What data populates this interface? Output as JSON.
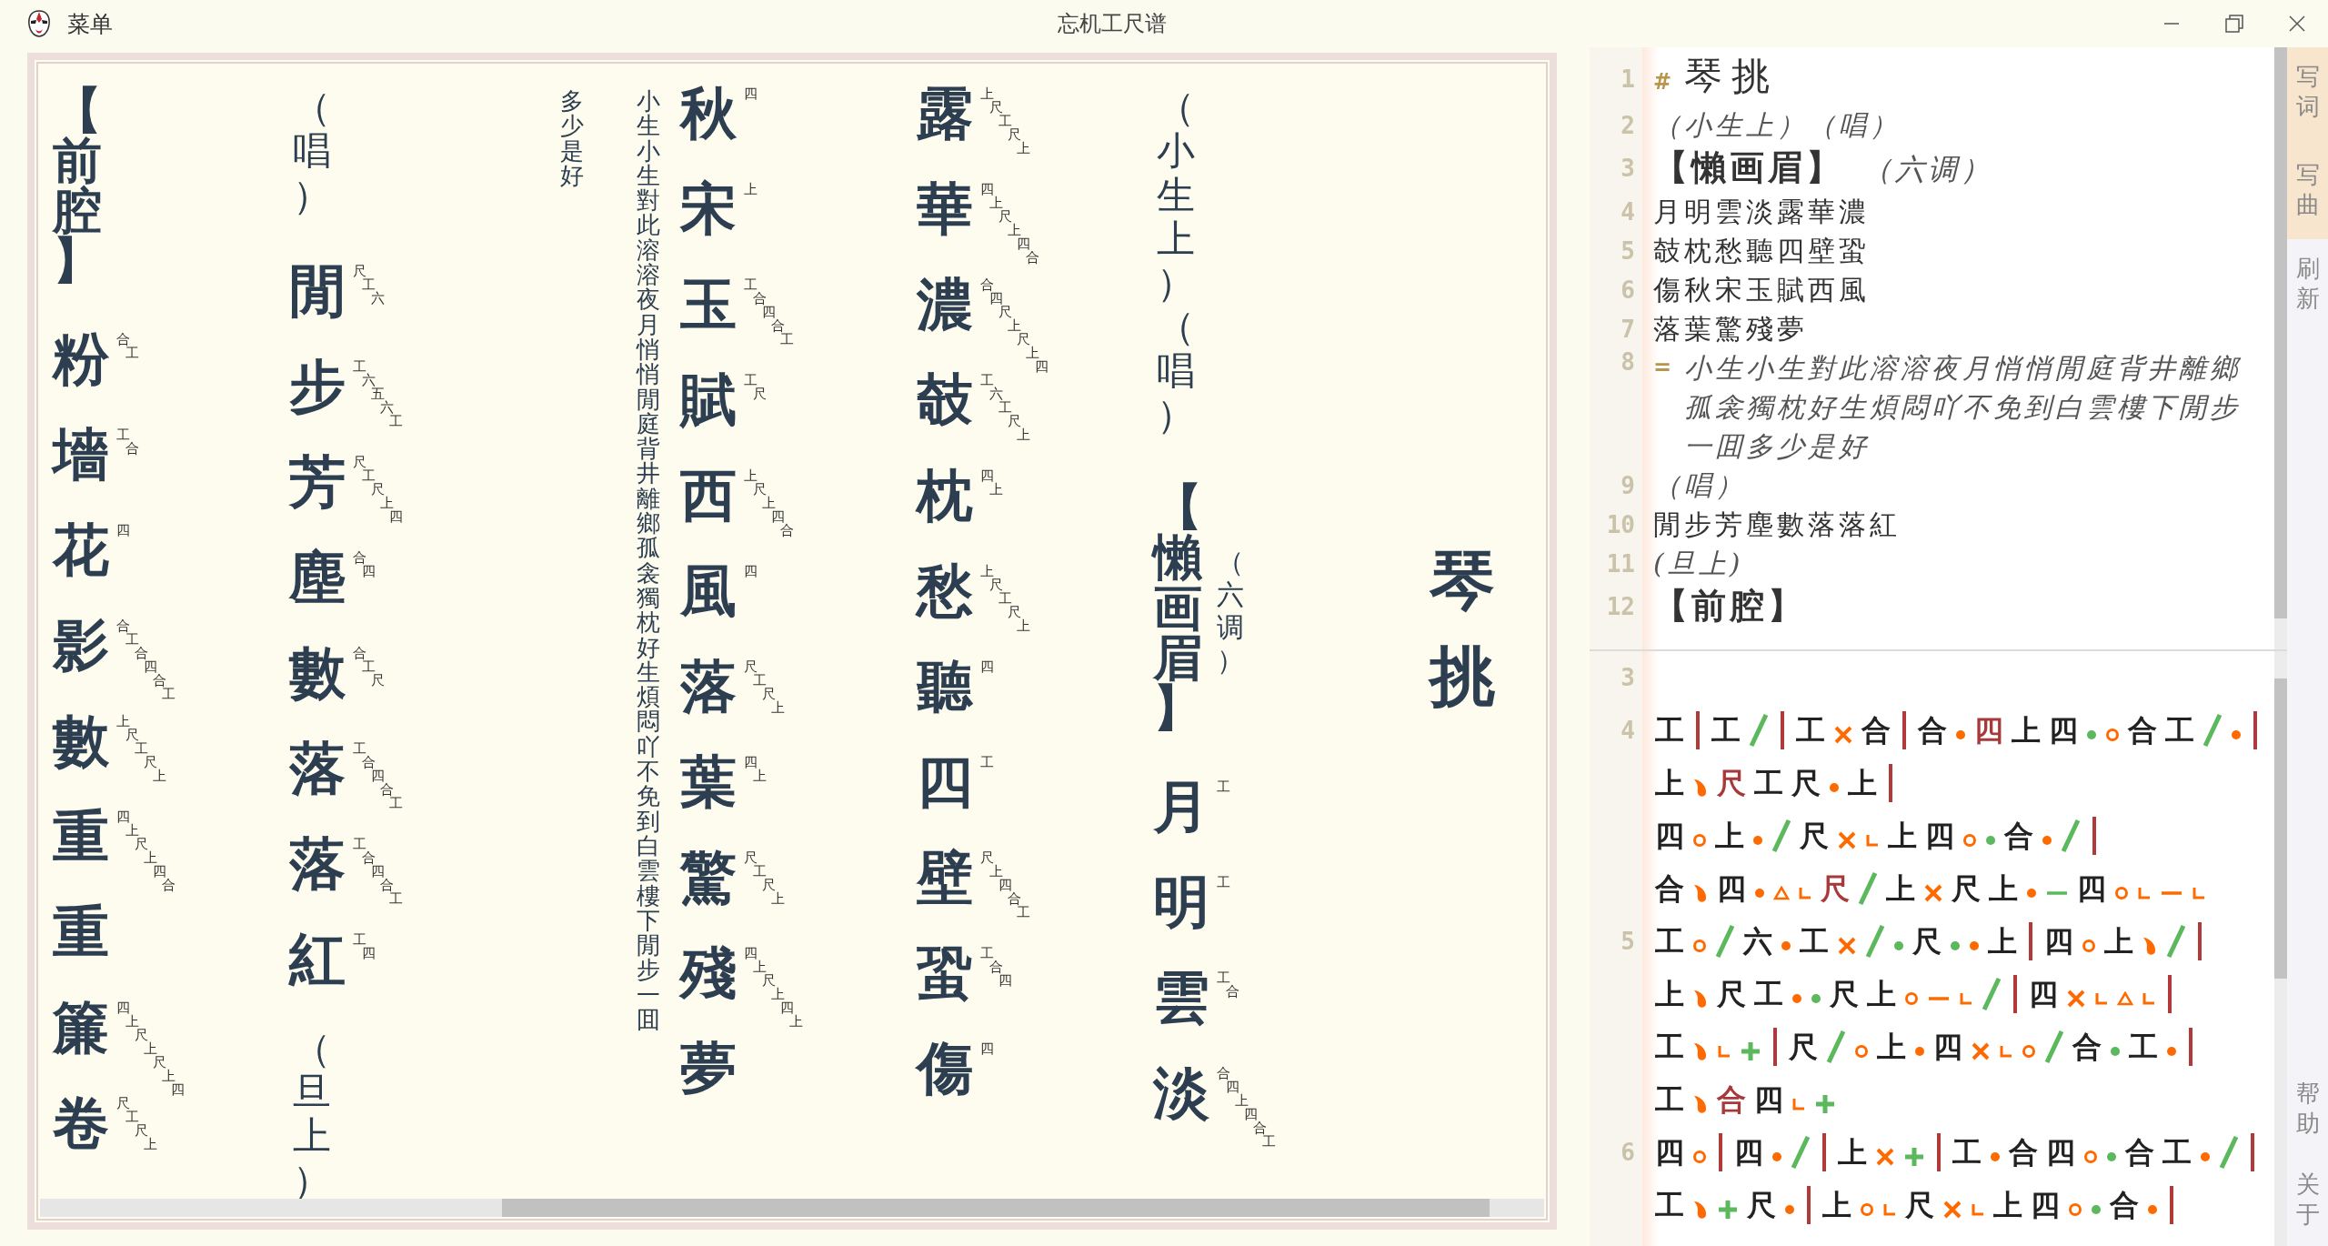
{
  "titlebar": {
    "menu": "菜单",
    "title": "忘机工尺谱"
  },
  "score": {
    "columns": [
      {
        "kind": "lyrics",
        "items": [
          {
            "kind": "tune",
            "text": "【前腔】"
          },
          {
            "kind": "char",
            "text": "粉",
            "notation": "合工"
          },
          {
            "kind": "char",
            "text": "墻",
            "notation": "工合"
          },
          {
            "kind": "char",
            "text": "花",
            "notation": "四"
          },
          {
            "kind": "char",
            "text": "影",
            "notation": "合工合四合工"
          },
          {
            "kind": "char",
            "text": "數",
            "notation": "上尺工尺上"
          },
          {
            "kind": "char",
            "text": "重",
            "notation": "四上尺上四合"
          },
          {
            "kind": "char",
            "text": "重"
          },
          {
            "kind": "char",
            "text": "簾",
            "notation": "四上尺上尺上四"
          },
          {
            "kind": "char",
            "text": "卷",
            "notation": "尺工尺上"
          }
        ]
      },
      {
        "kind": "lyrics",
        "items": [
          {
            "kind": "stage",
            "text": "（唱）"
          },
          {
            "kind": "char",
            "text": "閒",
            "notation": "尺工六"
          },
          {
            "kind": "char",
            "text": "步",
            "notation": "工六五六工"
          },
          {
            "kind": "char",
            "text": "芳",
            "notation": "尺工尺上四"
          },
          {
            "kind": "char",
            "text": "塵",
            "notation": "合四"
          },
          {
            "kind": "char",
            "text": "數",
            "notation": "合工尺"
          },
          {
            "kind": "char",
            "text": "落",
            "notation": "工合四合工"
          },
          {
            "kind": "char",
            "text": "落",
            "notation": "工合四合工"
          },
          {
            "kind": "char",
            "text": "紅",
            "notation": "工四"
          },
          {
            "kind": "stage",
            "text": "（旦上）"
          }
        ]
      },
      {
        "kind": "speech",
        "lines": [
          "多少是好",
          "小生小生對此溶溶夜月悄悄閒庭背井離鄉孤衾獨枕好生煩悶吖不免到白雲樓下閒步一囬"
        ]
      },
      {
        "kind": "lyrics",
        "items": [
          {
            "kind": "char",
            "text": "秋",
            "notation": "四"
          },
          {
            "kind": "char",
            "text": "宋",
            "notation": "上"
          },
          {
            "kind": "char",
            "text": "玉",
            "notation": "工合四合工"
          },
          {
            "kind": "char",
            "text": "賦",
            "notation": "工尺"
          },
          {
            "kind": "char",
            "text": "西",
            "notation": "上尺上四合"
          },
          {
            "kind": "char",
            "text": "風",
            "notation": "四"
          },
          {
            "kind": "char",
            "text": "落",
            "notation": "尺工尺上"
          },
          {
            "kind": "char",
            "text": "葉",
            "notation": "四上"
          },
          {
            "kind": "char",
            "text": "驚",
            "notation": "尺工尺上"
          },
          {
            "kind": "char",
            "text": "殘",
            "notation": "四上尺上四上"
          },
          {
            "kind": "char",
            "text": "夢"
          }
        ]
      },
      {
        "kind": "lyrics",
        "items": [
          {
            "kind": "char",
            "text": "露",
            "notation": "上尺工尺上"
          },
          {
            "kind": "char",
            "text": "華",
            "notation": "四上尺上四合"
          },
          {
            "kind": "char",
            "text": "濃",
            "notation": "合四尺上尺上四"
          },
          {
            "kind": "char",
            "text": "攲",
            "notation": "工六工尺上"
          },
          {
            "kind": "char",
            "text": "枕",
            "notation": "四上"
          },
          {
            "kind": "char",
            "text": "愁",
            "notation": "上尺工尺上"
          },
          {
            "kind": "char",
            "text": "聽",
            "notation": "四"
          },
          {
            "kind": "char",
            "text": "四",
            "notation": "工"
          },
          {
            "kind": "char",
            "text": "壁",
            "notation": "尺上四合工"
          },
          {
            "kind": "char",
            "text": "蛩",
            "notation": "工合四"
          },
          {
            "kind": "char",
            "text": "傷",
            "notation": "四"
          }
        ]
      },
      {
        "kind": "lyrics",
        "items": [
          {
            "kind": "stage",
            "text": "（小生上）（唱）"
          },
          {
            "kind": "tune",
            "text": "【懶画眉】",
            "note": "（六调）"
          },
          {
            "kind": "char",
            "text": "月",
            "notation": "工"
          },
          {
            "kind": "char",
            "text": "明",
            "notation": "工"
          },
          {
            "kind": "char",
            "text": "雲",
            "notation": "工合"
          },
          {
            "kind": "char",
            "text": "淡",
            "notation": "合四上四合工"
          }
        ]
      },
      {
        "kind": "title",
        "text": "琴挑"
      }
    ]
  },
  "editor": {
    "lines": [
      {
        "num": "1",
        "kind": "heading",
        "marker": "#",
        "text": "琴挑"
      },
      {
        "num": "2",
        "kind": "stage",
        "text": "（小生上）（唱）"
      },
      {
        "num": "3",
        "kind": "tune",
        "text": "【懶画眉】",
        "note": "（六调）"
      },
      {
        "num": "4",
        "kind": "lyric",
        "text": "月明雲淡露華濃"
      },
      {
        "num": "5",
        "kind": "lyric",
        "text": "攲枕愁聽四壁蛩"
      },
      {
        "num": "6",
        "kind": "lyric",
        "text": "傷秋宋玉賦西風"
      },
      {
        "num": "7",
        "kind": "lyric",
        "text": "落葉驚殘夢"
      },
      {
        "num": "8",
        "kind": "speech",
        "marker": "=",
        "text": "小生小生對此溶溶夜月悄悄閒庭背井離鄉孤衾獨枕好生煩悶吖不免到白雲樓下閒步一囬多少是好"
      },
      {
        "num": "9",
        "kind": "stage",
        "text": "（唱）"
      },
      {
        "num": "10",
        "kind": "lyric",
        "text": "閒步芳塵數落落紅"
      },
      {
        "num": "11",
        "kind": "stage",
        "text": "(旦上)"
      },
      {
        "num": "12",
        "kind": "tune",
        "text": "【前腔】"
      }
    ]
  },
  "notation": {
    "lines": [
      {
        "num": "3"
      },
      {
        "num": "4",
        "rows": [
          [
            {
              "kind": "note",
              "text": "工"
            },
            {
              "kind": "bar"
            },
            {
              "kind": "note",
              "text": "工"
            },
            {
              "kind": "slash"
            },
            {
              "kind": "bar"
            },
            {
              "kind": "note",
              "text": "工"
            },
            {
              "kind": "cross"
            },
            {
              "kind": "note",
              "text": "合"
            },
            {
              "kind": "bar"
            },
            {
              "kind": "note",
              "text": "合"
            },
            {
              "kind": "dot",
              "color": "#ff6a00"
            },
            {
              "kind": "note",
              "text": "四",
              "color": "#a8393a"
            },
            {
              "kind": "note",
              "text": "上"
            },
            {
              "kind": "note",
              "text": "四"
            },
            {
              "kind": "dot",
              "color": "#5cb85c"
            },
            {
              "kind": "ring"
            },
            {
              "kind": "note",
              "text": "合"
            },
            {
              "kind": "note",
              "text": "工"
            },
            {
              "kind": "slash"
            },
            {
              "kind": "dot",
              "color": "#ff6a00"
            },
            {
              "kind": "bar"
            }
          ],
          [
            {
              "kind": "note",
              "text": "上"
            },
            {
              "kind": "drop"
            },
            {
              "kind": "note",
              "text": "尺",
              "color": "#a8393a"
            },
            {
              "kind": "note",
              "text": "工"
            },
            {
              "kind": "note",
              "text": "尺"
            },
            {
              "kind": "dot",
              "color": "#ff6a00"
            },
            {
              "kind": "note",
              "text": "上"
            },
            {
              "kind": "bar"
            }
          ],
          [
            {
              "kind": "note",
              "text": "四"
            },
            {
              "kind": "ring"
            },
            {
              "kind": "note",
              "text": "上"
            },
            {
              "kind": "dot",
              "color": "#ff6a00"
            },
            {
              "kind": "slash"
            },
            {
              "kind": "note",
              "text": "尺"
            },
            {
              "kind": "cross"
            },
            {
              "kind": "hook"
            },
            {
              "kind": "note",
              "text": "上"
            },
            {
              "kind": "note",
              "text": "四"
            },
            {
              "kind": "ring"
            },
            {
              "kind": "dot",
              "color": "#5cb85c"
            },
            {
              "kind": "note",
              "text": "合"
            },
            {
              "kind": "dot",
              "color": "#ff6a00"
            },
            {
              "kind": "slash"
            },
            {
              "kind": "bar"
            }
          ],
          [
            {
              "kind": "note",
              "text": "合"
            },
            {
              "kind": "drop"
            },
            {
              "kind": "note",
              "text": "四"
            },
            {
              "kind": "dot",
              "color": "#ff6a00"
            },
            {
              "kind": "triangle"
            },
            {
              "kind": "hook"
            },
            {
              "kind": "note",
              "text": "尺",
              "color": "#a8393a"
            },
            {
              "kind": "slash"
            },
            {
              "kind": "note",
              "text": "上"
            },
            {
              "kind": "cross"
            },
            {
              "kind": "note",
              "text": "尺"
            },
            {
              "kind": "note",
              "text": "上"
            },
            {
              "kind": "dot",
              "color": "#ff6a00"
            },
            {
              "kind": "dash",
              "color": "#5cb85c"
            },
            {
              "kind": "note",
              "text": "四"
            },
            {
              "kind": "ring"
            },
            {
              "kind": "hook"
            },
            {
              "kind": "dash",
              "color": "#ff6a00"
            },
            {
              "kind": "hook"
            }
          ]
        ]
      },
      {
        "num": "5",
        "rows": [
          [
            {
              "kind": "note",
              "text": "工"
            },
            {
              "kind": "ring"
            },
            {
              "kind": "slash"
            },
            {
              "kind": "note",
              "text": "六"
            },
            {
              "kind": "dot",
              "color": "#ff6a00"
            },
            {
              "kind": "note",
              "text": "工"
            },
            {
              "kind": "cross"
            },
            {
              "kind": "slash"
            },
            {
              "kind": "dot",
              "color": "#5cb85c"
            },
            {
              "kind": "note",
              "text": "尺"
            },
            {
              "kind": "dot",
              "color": "#5cb85c"
            },
            {
              "kind": "dot",
              "color": "#ff6a00"
            },
            {
              "kind": "note",
              "text": "上"
            },
            {
              "kind": "bar"
            },
            {
              "kind": "note",
              "text": "四"
            },
            {
              "kind": "ring"
            },
            {
              "kind": "note",
              "text": "上"
            },
            {
              "kind": "drop"
            },
            {
              "kind": "slash"
            },
            {
              "kind": "bar"
            }
          ],
          [
            {
              "kind": "note",
              "text": "上"
            },
            {
              "kind": "drop"
            },
            {
              "kind": "note",
              "text": "尺"
            },
            {
              "kind": "note",
              "text": "工"
            },
            {
              "kind": "dot",
              "color": "#ff6a00"
            },
            {
              "kind": "dot",
              "color": "#5cb85c"
            },
            {
              "kind": "note",
              "text": "尺"
            },
            {
              "kind": "note",
              "text": "上"
            },
            {
              "kind": "ring"
            },
            {
              "kind": "dash",
              "color": "#ff6a00"
            },
            {
              "kind": "hook"
            },
            {
              "kind": "slash"
            },
            {
              "kind": "bar"
            },
            {
              "kind": "note",
              "text": "四"
            },
            {
              "kind": "cross"
            },
            {
              "kind": "hook"
            },
            {
              "kind": "triangle"
            },
            {
              "kind": "hook"
            },
            {
              "kind": "bar"
            }
          ],
          [
            {
              "kind": "note",
              "text": "工"
            },
            {
              "kind": "drop"
            },
            {
              "kind": "hook"
            },
            {
              "kind": "plus"
            },
            {
              "kind": "bar"
            },
            {
              "kind": "note",
              "text": "尺"
            },
            {
              "kind": "slash"
            },
            {
              "kind": "ring"
            },
            {
              "kind": "note",
              "text": "上"
            },
            {
              "kind": "dot",
              "color": "#ff6a00"
            },
            {
              "kind": "note",
              "text": "四"
            },
            {
              "kind": "cross"
            },
            {
              "kind": "hook"
            },
            {
              "kind": "ring"
            },
            {
              "kind": "slash"
            },
            {
              "kind": "note",
              "text": "合"
            },
            {
              "kind": "dot",
              "color": "#5cb85c"
            },
            {
              "kind": "note",
              "text": "工"
            },
            {
              "kind": "dot",
              "color": "#ff6a00"
            },
            {
              "kind": "bar"
            }
          ],
          [
            {
              "kind": "note",
              "text": "工"
            },
            {
              "kind": "drop"
            },
            {
              "kind": "note",
              "text": "合",
              "color": "#a8393a"
            },
            {
              "kind": "note",
              "text": "四"
            },
            {
              "kind": "hook"
            },
            {
              "kind": "plus"
            }
          ]
        ]
      },
      {
        "num": "6",
        "rows": [
          [
            {
              "kind": "note",
              "text": "四"
            },
            {
              "kind": "ring"
            },
            {
              "kind": "bar"
            },
            {
              "kind": "note",
              "text": "四"
            },
            {
              "kind": "dot",
              "color": "#ff6a00"
            },
            {
              "kind": "slash"
            },
            {
              "kind": "bar"
            },
            {
              "kind": "note",
              "text": "上"
            },
            {
              "kind": "cross"
            },
            {
              "kind": "plus"
            },
            {
              "kind": "bar"
            },
            {
              "kind": "note",
              "text": "工"
            },
            {
              "kind": "dot",
              "color": "#ff6a00"
            },
            {
              "kind": "note",
              "text": "合"
            },
            {
              "kind": "note",
              "text": "四"
            },
            {
              "kind": "ring"
            },
            {
              "kind": "dot",
              "color": "#5cb85c"
            },
            {
              "kind": "note",
              "text": "合"
            },
            {
              "kind": "note",
              "text": "工"
            },
            {
              "kind": "dot",
              "color": "#ff6a00"
            },
            {
              "kind": "slash"
            },
            {
              "kind": "bar"
            }
          ],
          [
            {
              "kind": "note",
              "text": "工"
            },
            {
              "kind": "drop"
            },
            {
              "kind": "plus"
            },
            {
              "kind": "note",
              "text": "尺"
            },
            {
              "kind": "dot",
              "color": "#ff6a00"
            },
            {
              "kind": "bar"
            },
            {
              "kind": "note",
              "text": "上"
            },
            {
              "kind": "ring"
            },
            {
              "kind": "hook"
            },
            {
              "kind": "note",
              "text": "尺"
            },
            {
              "kind": "cross"
            },
            {
              "kind": "hook"
            },
            {
              "kind": "note",
              "text": "上"
            },
            {
              "kind": "note",
              "text": "四"
            },
            {
              "kind": "ring"
            },
            {
              "kind": "dot",
              "color": "#5cb85c"
            },
            {
              "kind": "note",
              "text": "合"
            },
            {
              "kind": "dot",
              "color": "#ff6a00"
            },
            {
              "kind": "bar"
            }
          ]
        ]
      }
    ]
  },
  "sidebar": [
    {
      "label": "写词",
      "active": true
    },
    {
      "label": "写曲",
      "active": true
    },
    {
      "label": "刷新",
      "active": false
    },
    {
      "label": "帮助",
      "active": false
    },
    {
      "label": "关于",
      "active": false
    }
  ]
}
